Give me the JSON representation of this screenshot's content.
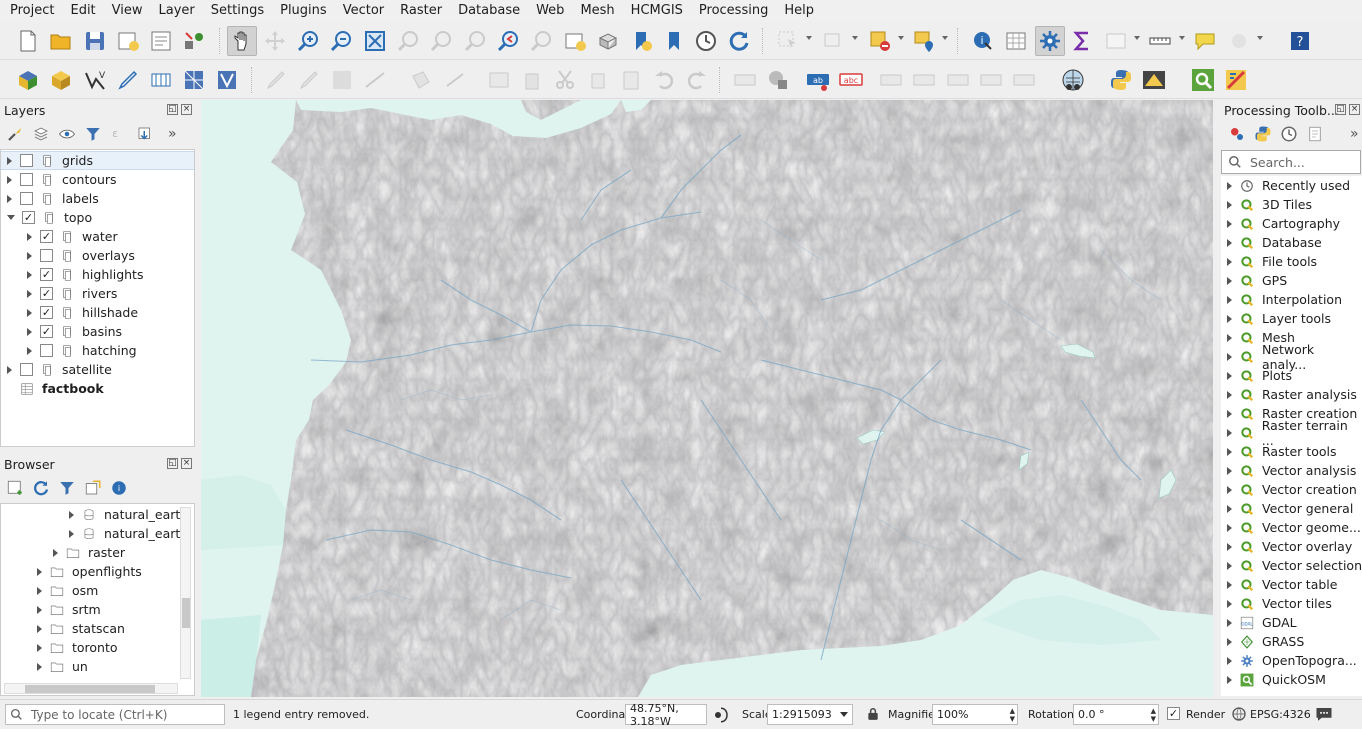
{
  "menu": [
    "Project",
    "Edit",
    "View",
    "Layer",
    "Settings",
    "Plugins",
    "Vector",
    "Raster",
    "Database",
    "Web",
    "Mesh",
    "HCMGIS",
    "Processing",
    "Help"
  ],
  "layers": {
    "title": "Layers",
    "items": [
      {
        "label": "grids",
        "level": 0,
        "expand": "right",
        "checked": false,
        "selected": true
      },
      {
        "label": "contours",
        "level": 0,
        "expand": "right",
        "checked": false
      },
      {
        "label": "labels",
        "level": 0,
        "expand": "right",
        "checked": false
      },
      {
        "label": "topo",
        "level": 0,
        "expand": "down",
        "checked": true
      },
      {
        "label": "water",
        "level": 1,
        "expand": "right",
        "checked": true
      },
      {
        "label": "overlays",
        "level": 1,
        "expand": "right",
        "checked": false
      },
      {
        "label": "highlights",
        "level": 1,
        "expand": "right",
        "checked": true
      },
      {
        "label": "rivers",
        "level": 1,
        "expand": "right",
        "checked": true
      },
      {
        "label": "hillshade",
        "level": 1,
        "expand": "right",
        "checked": true
      },
      {
        "label": "basins",
        "level": 1,
        "expand": "right",
        "checked": true
      },
      {
        "label": "hatching",
        "level": 1,
        "expand": "right",
        "checked": false
      },
      {
        "label": "satellite",
        "level": 0,
        "expand": "right",
        "checked": false
      },
      {
        "label": "factbook",
        "level": 0,
        "expand": "none",
        "table": true,
        "bold": true
      }
    ]
  },
  "browser": {
    "title": "Browser",
    "items": [
      {
        "label": "natural_earth",
        "kind": "db",
        "level": 3
      },
      {
        "label": "natural_earth",
        "kind": "db",
        "level": 3
      },
      {
        "label": "raster",
        "kind": "folder",
        "level": 2
      },
      {
        "label": "openflights",
        "kind": "folder",
        "level": 1
      },
      {
        "label": "osm",
        "kind": "folder",
        "level": 1
      },
      {
        "label": "srtm",
        "kind": "folder",
        "level": 1
      },
      {
        "label": "statscan",
        "kind": "folder",
        "level": 1
      },
      {
        "label": "toronto",
        "kind": "folder",
        "level": 1
      },
      {
        "label": "un",
        "kind": "folder",
        "level": 1
      }
    ]
  },
  "processing": {
    "title": "Processing Toolb...",
    "search_placeholder": "Search...",
    "items": [
      {
        "label": "Recently used",
        "icon": "clock"
      },
      {
        "label": "3D Tiles",
        "icon": "q"
      },
      {
        "label": "Cartography",
        "icon": "q"
      },
      {
        "label": "Database",
        "icon": "q"
      },
      {
        "label": "File tools",
        "icon": "q"
      },
      {
        "label": "GPS",
        "icon": "q"
      },
      {
        "label": "Interpolation",
        "icon": "q"
      },
      {
        "label": "Layer tools",
        "icon": "q"
      },
      {
        "label": "Mesh",
        "icon": "q"
      },
      {
        "label": "Network analy...",
        "icon": "q"
      },
      {
        "label": "Plots",
        "icon": "q"
      },
      {
        "label": "Raster analysis",
        "icon": "q"
      },
      {
        "label": "Raster creation",
        "icon": "q"
      },
      {
        "label": "Raster terrain ...",
        "icon": "q"
      },
      {
        "label": "Raster tools",
        "icon": "q"
      },
      {
        "label": "Vector analysis",
        "icon": "q"
      },
      {
        "label": "Vector creation",
        "icon": "q"
      },
      {
        "label": "Vector general",
        "icon": "q"
      },
      {
        "label": "Vector geome...",
        "icon": "q"
      },
      {
        "label": "Vector overlay",
        "icon": "q"
      },
      {
        "label": "Vector selection",
        "icon": "q"
      },
      {
        "label": "Vector table",
        "icon": "q"
      },
      {
        "label": "Vector tiles",
        "icon": "q"
      },
      {
        "label": "GDAL",
        "icon": "gdal"
      },
      {
        "label": "GRASS",
        "icon": "grass"
      },
      {
        "label": "OpenTopogra...",
        "icon": "gear"
      },
      {
        "label": "QuickOSM",
        "icon": "osm"
      }
    ]
  },
  "status": {
    "locate_placeholder": "Type to locate (Ctrl+K)",
    "message": "1 legend entry removed.",
    "coordinate_label": "Coordinate",
    "coordinate": "48.75°N, 3.18°W",
    "scale_label": "Scale",
    "scale": "1:2915093",
    "magnifier_label": "Magnifier",
    "magnifier": "100%",
    "rotation_label": "Rotation",
    "rotation": "0.0 °",
    "render_label": "Render",
    "render_checked": true,
    "crs": "EPSG:4326"
  },
  "colors": {
    "water": "#dff3ef",
    "terrain": "#e2e2e2",
    "river": "#7aa6c4",
    "accent": "#3c8e2e"
  }
}
